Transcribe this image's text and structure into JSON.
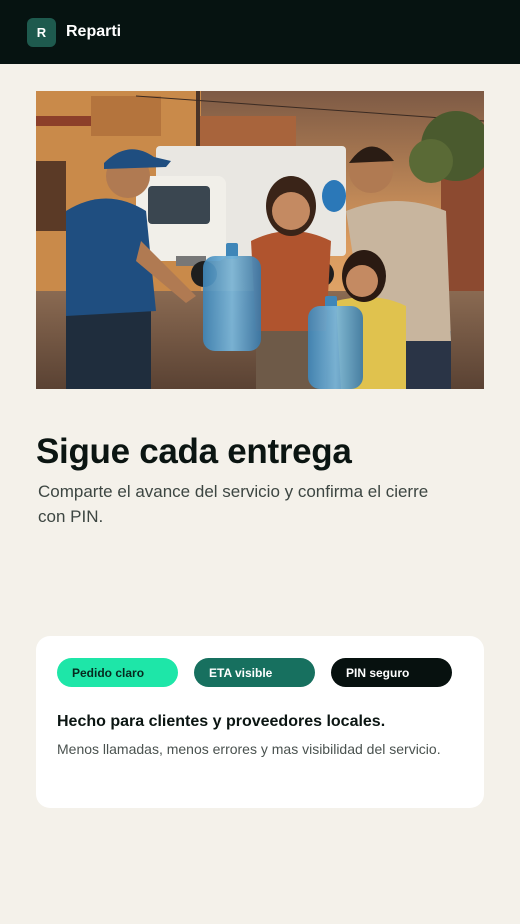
{
  "header": {
    "logo_letter": "R",
    "app_name": "Reparti"
  },
  "hero": {
    "image_subject": "water-delivery-family-photo",
    "truck_logo_glyph": "droplet"
  },
  "main": {
    "title": "Sigue cada entrega",
    "subtitle": "Comparte el avance del servicio y confirma el cierre con PIN."
  },
  "card": {
    "chips": [
      {
        "label": "Pedido claro",
        "color": "#1ee6a8"
      },
      {
        "label": "ETA visible",
        "color": "#17705f"
      },
      {
        "label": "PIN seguro",
        "color": "#07110f"
      }
    ],
    "title": "Hecho para clientes y proveedores locales.",
    "text": "Menos llamadas, menos errores y mas visibilidad del servicio."
  },
  "colors": {
    "topbar": "#061311",
    "background": "#f4f1ea",
    "accent": "#1ee6a8"
  }
}
